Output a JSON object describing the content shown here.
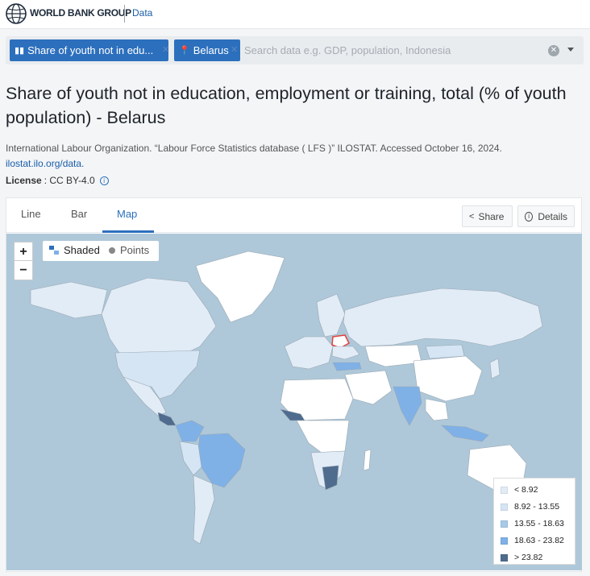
{
  "header": {
    "brand": "WORLD BANK GROUP",
    "section_link": "Data"
  },
  "search": {
    "chip_indicator": "Share of youth not in edu...",
    "chip_country": "Belarus",
    "placeholder": "Search data e.g. GDP, population, Indonesia",
    "value": ""
  },
  "indicator": {
    "title": "Share of youth not in education, employment or training, total (% of youth population) - Belarus",
    "source": "International Labour Organization. “Labour Force Statistics database ( LFS )” ILOSTAT. Accessed October 16, 2024.",
    "source_link": "ilostat.ilo.org/data.",
    "license_label": "License",
    "license_value": ": CC BY-4.0"
  },
  "tabs": {
    "line": "Line",
    "bar": "Bar",
    "map": "Map",
    "active": "Map"
  },
  "actions": {
    "share": "Share",
    "details": "Details"
  },
  "map": {
    "zoom_in": "+",
    "zoom_out": "−",
    "mode_shaded": "Shaded",
    "mode_points": "Points",
    "active_mode": "Shaded",
    "highlighted_country": "Belarus",
    "highlight_color": "#e0443e",
    "ocean_color": "#aec8d9",
    "no_data_color": "#ffffff",
    "legend": [
      {
        "label": "< 8.92",
        "color": "#e2ecf6"
      },
      {
        "label": "8.92 - 13.55",
        "color": "#d5e5f4"
      },
      {
        "label": "13.55 - 18.63",
        "color": "#a8c9e8"
      },
      {
        "label": "18.63 - 23.82",
        "color": "#7fb1e7"
      },
      {
        "label": "> 23.82",
        "color": "#4f6c8e"
      }
    ]
  },
  "colors": {
    "accent": "#2c6fbd",
    "chip_bg": "#2c6fbd"
  }
}
